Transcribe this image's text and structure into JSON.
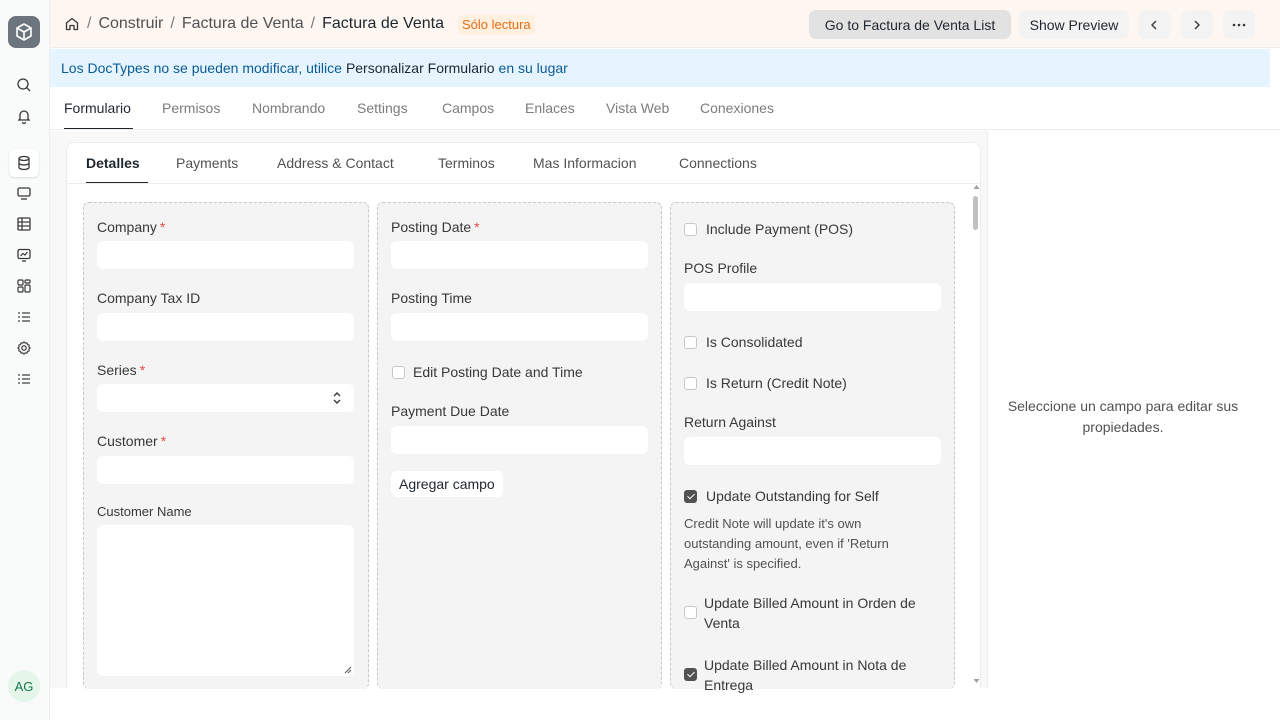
{
  "breadcrumb": {
    "items": [
      "Construir",
      "Factura de Venta"
    ],
    "current": "Factura de Venta",
    "badge": "Sólo lectura"
  },
  "header": {
    "go_to_list_label": "Go to Factura de Venta List",
    "show_preview_label": "Show Preview"
  },
  "alert": {
    "text_before": "Los DocTypes no se pueden modificar, utilice",
    "link": "Personalizar Formulario",
    "text_after": "en su lugar"
  },
  "main_tabs": [
    "Formulario",
    "Permisos",
    "Nombrando",
    "Settings",
    "Campos",
    "Enlaces",
    "Vista Web",
    "Conexiones"
  ],
  "form_tabs": [
    "Detalles",
    "Payments",
    "Address & Contact",
    "Terminos",
    "Mas Informacion",
    "Connections"
  ],
  "column1": {
    "company": "Company",
    "company_tax_id": "Company Tax ID",
    "series": "Series",
    "customer": "Customer",
    "customer_name": "Customer Name"
  },
  "column2": {
    "posting_date": "Posting Date",
    "posting_time": "Posting Time",
    "edit_posting": "Edit Posting Date and Time",
    "payment_due_date": "Payment Due Date",
    "add_field": "Agregar campo"
  },
  "column3": {
    "include_payment": "Include Payment (POS)",
    "pos_profile": "POS Profile",
    "is_consolidated": "Is Consolidated",
    "is_return": "Is Return (Credit Note)",
    "return_against": "Return Against",
    "update_outstanding": "Update Outstanding for Self",
    "update_outstanding_desc_1": "Credit Note will update it's own",
    "update_outstanding_desc_2": "outstanding amount, even if 'Return",
    "update_outstanding_desc_3": "Against' is specified.",
    "update_billed_so_1": "Update Billed Amount in Orden de",
    "update_billed_so_2": "Venta",
    "update_billed_dn_1": "Update Billed Amount in Nota de",
    "update_billed_dn_2": "Entrega"
  },
  "right_panel": {
    "line1": "Seleccione un campo para editar sus",
    "line2": "propiedades."
  },
  "user": {
    "initials": "AG"
  },
  "colors": {
    "accent": "#1f272e",
    "badge": "#e86c13",
    "alert_bg": "#e6f4ff",
    "alert_text": "#0a5c94",
    "required": "#e24c4c"
  }
}
